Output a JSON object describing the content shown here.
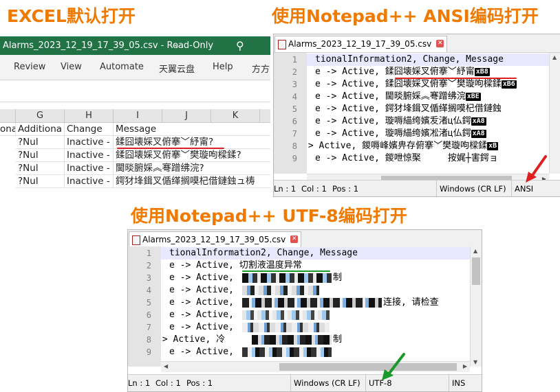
{
  "titles": {
    "excel": "EXCEL默认打开",
    "ansi": "使用Notepad++ ANSI编码打开",
    "utf8": "使用Notepad++ UTF-8编码打开"
  },
  "excel": {
    "window_title": "Alarms_2023_12_19_17_39_05.csv  -  Read-Only",
    "ribbon_tabs": [
      "Review",
      "View",
      "Automate",
      "天翼云盘",
      "Help",
      "方方"
    ],
    "columns": [
      "G",
      "H",
      "I",
      "J",
      "K"
    ],
    "header_row": [
      "ona",
      "Additiona",
      "Change",
      "Message"
    ],
    "rows": [
      {
        "a": "?Nul",
        "change": "Inactive - :",
        "msg": "鍒囧壊婇叉俯搴﹀紓甯?"
      },
      {
        "a": "?Nul",
        "change": "Inactive - :",
        "msg": "鍒囧壊婇叉俯搴﹀樊璇呴樑鍒?"
      },
      {
        "a": "?Nul",
        "change": "Inactive - :",
        "msg": "閫晱腑婇︽弿蹭绋浣?"
      },
      {
        "a": "?Nul",
        "change": "Inactive - :",
        "msg": "鍔犲埄鍓叉偱缂搁嗼杞借鏈鉵ュ梼"
      }
    ],
    "colors": {
      "titlebar": "#217346",
      "underline": "#e02020"
    }
  },
  "np_ansi": {
    "tab": "Alarms_2023_12_19_17_39_05.csv",
    "line_numbers": [
      "1",
      "2",
      "3",
      "4",
      "5",
      "6",
      "7",
      "8",
      "9"
    ],
    "lines": [
      {
        "text": "tionalInformation2, Change, Message",
        "ctrl": ""
      },
      {
        "text": "e -> Active, 鍒囧壊婇叉俯搴﹀紓甯",
        "ctrl": "xB8"
      },
      {
        "text": "e -> Active, 鍒囧壊婇叉俯搴﹀樊璇呴樑鍒",
        "ctrl": "xB6"
      },
      {
        "text": "e -> Active, 閫晱腑婇︽弿蹭绋浣",
        "ctrl": "xBE"
      },
      {
        "text": "e -> Active, 鍔犲埄鍓叉偱缂搁嗼杞借鏈鉵",
        "ctrl": ""
      },
      {
        "text": "e -> Active, 璇嗕緢绔嬪叐渚ц仏鍔",
        "ctrl": "xA8"
      },
      {
        "text": "e -> Active, 璇嗕緢绔嬪凇渚ц仏鍔",
        "ctrl": "xA8"
      },
      {
        "text": "-> Active, 鍐嗕峰嬪畁存俯搴﹀樊璇呴樑鍒",
        "ctrl": "xB"
      },
      {
        "text": "e -> Active, 鍐呭惊棸     按娓┼害鍔ョ",
        "ctrl": ""
      }
    ],
    "status": {
      "ln": "Ln : 1",
      "col": "Col : 1",
      "pos": "Pos : 1",
      "eol": "Windows (CR LF)",
      "encoding": "ANSI"
    }
  },
  "np_utf8": {
    "tab": "Alarms_2023_12_19_17_39_05.csv",
    "line_numbers": [
      "1",
      "2",
      "3",
      "4",
      "5",
      "6",
      "7",
      "8",
      "9"
    ],
    "lines": [
      {
        "text": "tionalInformation2, Change, Message",
        "tail": ""
      },
      {
        "text": "e -> Active, 切割液温度异常",
        "tail": ""
      },
      {
        "text": "e -> Active, ",
        "tail": "制"
      },
      {
        "text": "e -> Active, ",
        "tail": ""
      },
      {
        "text": "e -> Active, ",
        "tail": "连接, 请检查"
      },
      {
        "text": "e -> Active, ",
        "tail": ""
      },
      {
        "text": "e -> Active, ",
        "tail": ""
      },
      {
        "text": "-> Active, 冷",
        "tail": "制"
      },
      {
        "text": "e -> Active, ",
        "tail": ""
      }
    ],
    "status": {
      "ln": "Ln : 1",
      "col": "Col : 1",
      "pos": "Pos : 1",
      "eol": "Windows (CR LF)",
      "encoding": "UTF-8",
      "ins": "INS"
    },
    "colors": {
      "underline": "#1a9a2a",
      "arrow": "#1a9a2a"
    }
  },
  "colors": {
    "title_orange": "#f07a00",
    "arrow_red": "#e02020"
  }
}
